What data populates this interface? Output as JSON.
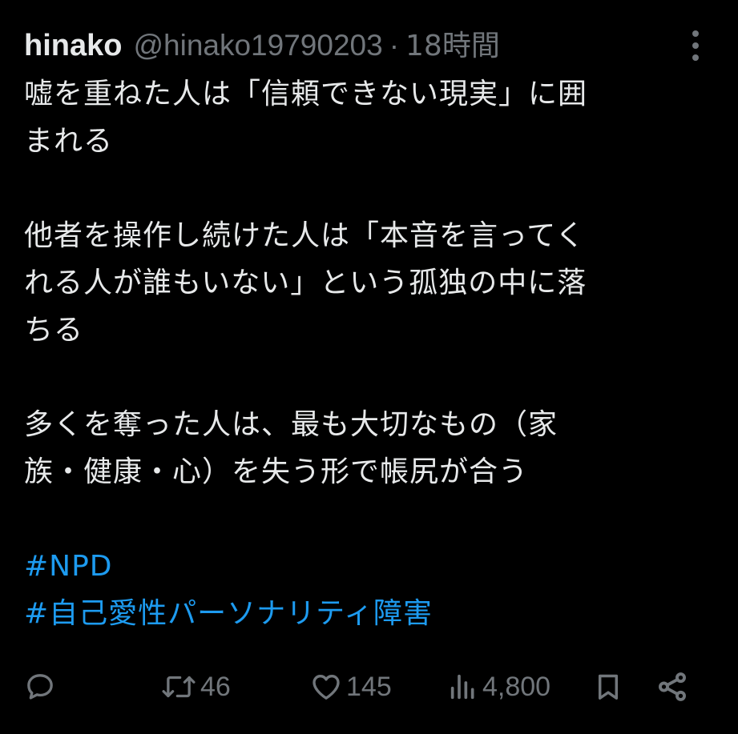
{
  "tweet": {
    "display_name": "hinako",
    "handle": "@hinako19790203",
    "separator": "·",
    "time": "18時間",
    "paragraphs": [
      [
        "嘘を重ねた人は「信頼できない現実」に囲",
        "まれる"
      ],
      [
        "他者を操作し続けた人は「本音を言ってく",
        "れる人が誰もいない」という孤独の中に落",
        "ちる"
      ],
      [
        "多くを奪った人は、最も大切なもの（家",
        "族・健康・心）を失う形で帳尻が合う"
      ]
    ],
    "hashtags": [
      "#NPD",
      "#自己愛性パーソナリティ障害"
    ]
  },
  "actions": {
    "reply": {
      "icon": "reply-icon",
      "count": ""
    },
    "retweet": {
      "icon": "retweet-icon",
      "count": "46"
    },
    "like": {
      "icon": "heart-icon",
      "count": "145"
    },
    "views": {
      "icon": "views-icon",
      "count": "4,800"
    },
    "bookmark": {
      "icon": "bookmark-icon",
      "count": ""
    },
    "share": {
      "icon": "share-icon",
      "count": ""
    }
  },
  "colors": {
    "background": "#000000",
    "text": "#e7e9ea",
    "muted": "#71767b",
    "link": "#1d9bf0"
  }
}
